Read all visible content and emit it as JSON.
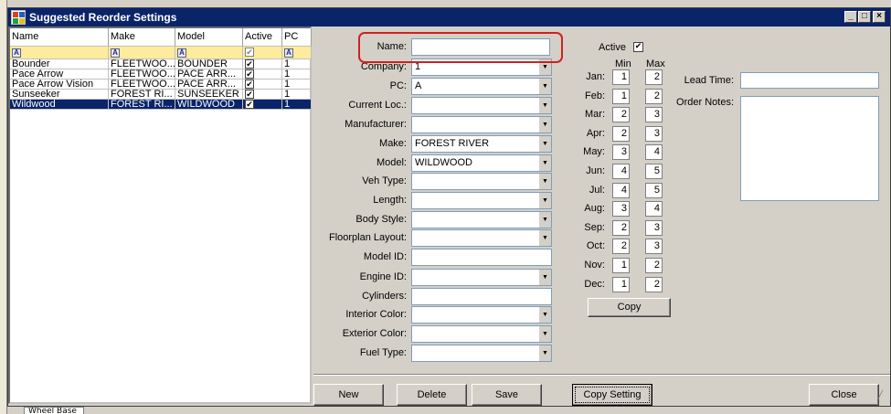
{
  "window": {
    "title": "Suggested Reorder Settings",
    "minimize": "_",
    "maximize": "□",
    "close": "×"
  },
  "background": {
    "bottom_tab": "Wheel Base"
  },
  "grid": {
    "columns": [
      "Name",
      "Make",
      "Model",
      "Active",
      "PC"
    ],
    "filter_icon": "A",
    "rows": [
      {
        "name": "Bounder",
        "make": "FLEETWOO...",
        "model": "BOUNDER",
        "active": true,
        "pc": "1"
      },
      {
        "name": "Pace Arrow",
        "make": "FLEETWOO...",
        "model": "PACE ARR...",
        "active": true,
        "pc": "1"
      },
      {
        "name": "Pace Arrow Vision",
        "make": "FLEETWOO...",
        "model": "PACE ARR...",
        "active": true,
        "pc": "1"
      },
      {
        "name": "Sunseeker",
        "make": "FOREST RI...",
        "model": "SUNSEEKER",
        "active": true,
        "pc": "1"
      },
      {
        "name": "Wildwood",
        "make": "FOREST RI...",
        "model": "WILDWOOD",
        "active": true,
        "pc": "1"
      }
    ],
    "selected_row": 4
  },
  "form": {
    "name": {
      "label": "Name:",
      "value": ""
    },
    "company": {
      "label": "Company:",
      "value": "1"
    },
    "pc": {
      "label": "PC:",
      "value": "A"
    },
    "current_loc": {
      "label": "Current Loc.:",
      "value": ""
    },
    "manufacturer": {
      "label": "Manufacturer:",
      "value": ""
    },
    "make": {
      "label": "Make:",
      "value": "FOREST RIVER"
    },
    "model": {
      "label": "Model:",
      "value": "WILDWOOD"
    },
    "veh_type": {
      "label": "Veh Type:",
      "value": ""
    },
    "length": {
      "label": "Length:",
      "value": ""
    },
    "body_style": {
      "label": "Body Style:",
      "value": ""
    },
    "floorplan_layout": {
      "label": "Floorplan Layout:",
      "value": ""
    },
    "model_id": {
      "label": "Model ID:",
      "value": ""
    },
    "engine_id": {
      "label": "Engine ID:",
      "value": ""
    },
    "cylinders": {
      "label": "Cylinders:",
      "value": ""
    },
    "interior_color": {
      "label": "Interior Color:",
      "value": ""
    },
    "exterior_color": {
      "label": "Exterior Color:",
      "value": ""
    },
    "fuel_type": {
      "label": "Fuel Type:",
      "value": ""
    }
  },
  "active": {
    "label": "Active",
    "checked": true
  },
  "minmax": {
    "min_label": "Min",
    "max_label": "Max",
    "months": [
      {
        "label": "Jan:",
        "min": "1",
        "max": "2"
      },
      {
        "label": "Feb:",
        "min": "1",
        "max": "2"
      },
      {
        "label": "Mar:",
        "min": "2",
        "max": "3"
      },
      {
        "label": "Apr:",
        "min": "2",
        "max": "3"
      },
      {
        "label": "May:",
        "min": "3",
        "max": "4"
      },
      {
        "label": "Jun:",
        "min": "4",
        "max": "5"
      },
      {
        "label": "Jul:",
        "min": "4",
        "max": "5"
      },
      {
        "label": "Aug:",
        "min": "3",
        "max": "4"
      },
      {
        "label": "Sep:",
        "min": "2",
        "max": "3"
      },
      {
        "label": "Oct:",
        "min": "2",
        "max": "3"
      },
      {
        "label": "Nov:",
        "min": "1",
        "max": "2"
      },
      {
        "label": "Dec:",
        "min": "1",
        "max": "2"
      }
    ],
    "copy_label": "Copy"
  },
  "lead_time": {
    "label": "Lead Time:",
    "value": ""
  },
  "order_notes": {
    "label": "Order Notes:",
    "value": ""
  },
  "buttons": {
    "new": "New",
    "delete": "Delete",
    "save": "Save",
    "copy_setting": "Copy Setting",
    "close": "Close"
  },
  "colors": {
    "titlebar": "#0a246a",
    "selection": "#0a246a",
    "filter_row": "#ffeb9c",
    "highlight": "#d02020"
  }
}
